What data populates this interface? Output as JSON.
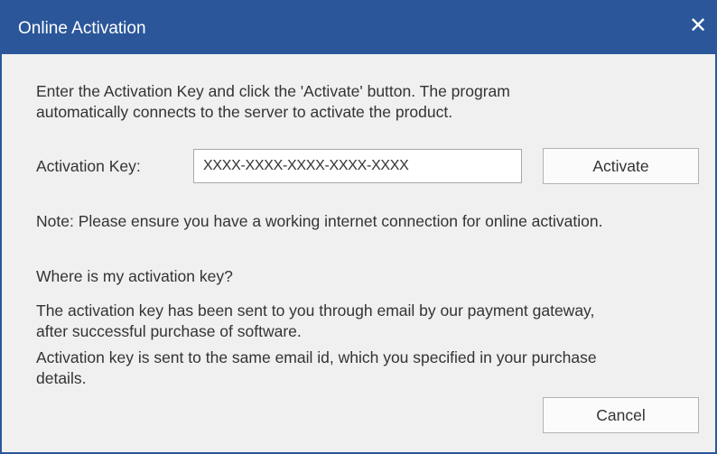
{
  "window": {
    "title": "Online Activation",
    "close_symbol": "✕",
    "title_bar_color": "#2b579a"
  },
  "intro": {
    "line1": "Enter the Activation Key and click the 'Activate' button. The program",
    "line2": "automatically connects to the server to activate the product."
  },
  "activation": {
    "label": "Activation Key:",
    "key_value": "XXXX-XXXX-XXXX-XXXX-XXXX",
    "activate_label": "Activate"
  },
  "note": "Note: Please ensure you have a working internet connection for online activation.",
  "help": {
    "question": "Where is my activation key?",
    "answer1_line1": "The activation key has been sent to you through email by our payment gateway,",
    "answer1_line2": "after successful purchase of software.",
    "answer2_line1": "Activation key is sent to the same email id, which you specified in your purchase",
    "answer2_line2": "details."
  },
  "footer": {
    "cancel_label": "Cancel"
  }
}
